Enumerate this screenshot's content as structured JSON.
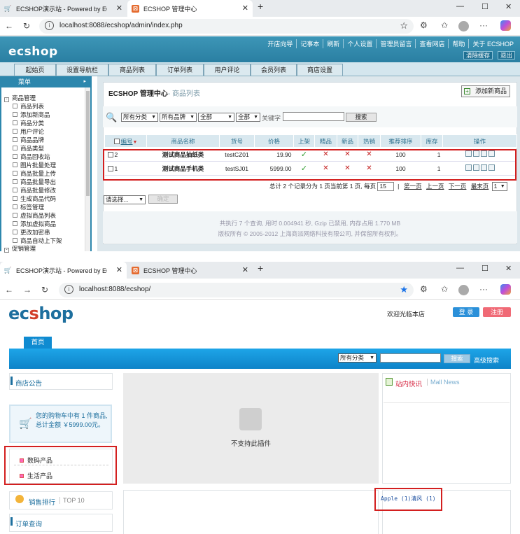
{
  "window1": {
    "tabs": [
      {
        "title": "ECSHOP演示站 - Powered by ECSHOP",
        "active": false
      },
      {
        "title": "ECSHOP 管理中心",
        "active": true
      }
    ],
    "url": "localhost:8088/ecshop/admin/index.php"
  },
  "window2": {
    "tabs": [
      {
        "title": "ECSHOP演示站 - Powered by ECSHOP",
        "active": true
      },
      {
        "title": "ECSHOP 管理中心",
        "active": false
      }
    ],
    "url": "localhost:8088/ecshop/"
  },
  "admin": {
    "logo": "ecshop",
    "top_links": [
      "开店向导",
      "记事本",
      "刷新",
      "个人设置",
      "管理员留言",
      "查看网店",
      "帮助",
      "关于 ECSHOP"
    ],
    "top_buttons": [
      "清除缓存",
      "退出"
    ],
    "menu_tabs": [
      "起始页",
      "设置导航栏",
      "商品列表",
      "订单列表",
      "用户评论",
      "会员列表",
      "商店设置"
    ],
    "sidebar_title": "菜单",
    "sidebar_items": [
      "商品管理",
      "商品列表",
      "添加新商品",
      "商品分类",
      "用户评论",
      "商品品牌",
      "商品类型",
      "商品回收站",
      "图片批量处理",
      "商品批量上传",
      "商品批量导出",
      "商品批量修改",
      "生成商品代码",
      "标签管理",
      "虚拟商品列表",
      "添加虚拟商品",
      "更改加密串",
      "商品自动上下架",
      "促销管理"
    ],
    "page_title": "ECSHOP 管理中心",
    "page_subtitle": "- 商品列表",
    "add_button": "添加新商品",
    "filters": {
      "category": "所有分类",
      "brand": "所有品牌",
      "scope1": "全部",
      "scope2": "全部",
      "keyword_label": "关键字",
      "search_button": "搜索"
    },
    "columns": [
      "编号",
      "商品名称",
      "货号",
      "价格",
      "上架",
      "精品",
      "新品",
      "热销",
      "推荐排序",
      "库存",
      "操作"
    ],
    "rows": [
      {
        "id": "2",
        "name": "测试商品抽纸类",
        "sn": "testCZ01",
        "price": "19.90",
        "sale": "✓",
        "best": "✕",
        "new": "✕",
        "hot": "✕",
        "sort": "100",
        "stock": "1"
      },
      {
        "id": "1",
        "name": "测试商品手机类",
        "sn": "testSJ01",
        "price": "5999.00",
        "sale": "✓",
        "best": "✕",
        "new": "✕",
        "hot": "✕",
        "sort": "100",
        "stock": "1"
      }
    ],
    "pager": {
      "summary": "总计 2 个记录分为 1 页当前第 1 页, 每页",
      "per_page": "15",
      "first": "第一页",
      "prev": "上一页",
      "next": "下一页",
      "last": "最末页",
      "page_select": "1"
    },
    "batch_select": "请选择...",
    "confirm_button": "确定",
    "footer_line1": "共执行 7 个查询, 用时 0.004941 秒, Gzip 已禁用, 内存占用 1.770 MB",
    "footer_line2": "版权所有 © 2005-2012 上海商派网络科技有限公司, 并保留所有权利。"
  },
  "shop": {
    "logo_part1": "ec",
    "logo_part2": "s",
    "logo_part3": "hop",
    "welcome": "欢迎光临本店",
    "login_button": "登 录",
    "register_button": "注册",
    "home_tab": "首页",
    "search_category": "所有分类",
    "search_button": "搜索",
    "advanced_search": "高级搜索",
    "notice_title": "商店公告",
    "cart_text": "您的购物车中有 1 件商品, 总计金额 ￥5999.00元。",
    "categories": [
      "数码产品",
      "生活产品"
    ],
    "plugin_text": "不支持此插件",
    "news_title": "站内快讯",
    "news_subtitle": "Mall News",
    "ranking_title": "销售排行",
    "ranking_sub": "TOP 10",
    "order_query": "订单查询",
    "tag_links": "Apple (1)清风 (1)"
  },
  "colors": {
    "admin_header": "#2f87ab",
    "shop_blue": "#0f8bd1",
    "highlight_red": "#d31f1f"
  }
}
